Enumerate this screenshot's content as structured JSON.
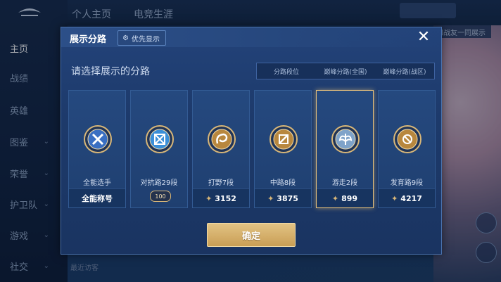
{
  "background": {
    "sidebar": [
      {
        "label": "主页",
        "active": true,
        "chev": false
      },
      {
        "label": "战绩",
        "active": false,
        "chev": false
      },
      {
        "label": "英雄",
        "active": false,
        "chev": false
      },
      {
        "label": "图鉴",
        "active": false,
        "chev": true
      },
      {
        "label": "荣誉",
        "active": false,
        "chev": true
      },
      {
        "label": "护卫队",
        "active": false,
        "chev": true
      },
      {
        "label": "游戏",
        "active": false,
        "chev": true
      },
      {
        "label": "社交",
        "active": false,
        "chev": true
      }
    ],
    "top_tabs": [
      "个人主页",
      "电竞生涯"
    ],
    "hint_text": "和战友一同展示",
    "bottom_left_text": "最近访客"
  },
  "dialog": {
    "title": "展示分路",
    "priority_label": "优先显示",
    "close_icon": "close-icon",
    "prompt": "请选择展示的分路",
    "tabs": [
      {
        "label": "分路段位",
        "active": true
      },
      {
        "label": "巅峰分路(全国)",
        "active": false
      },
      {
        "label": "巅峰分路(战区)",
        "active": false
      }
    ],
    "confirm_label": "确定"
  },
  "cards": [
    {
      "name": "全能选手",
      "foot": "全能称号",
      "kind": "text",
      "emblem": "all-round-emblem-icon",
      "selected": false
    },
    {
      "name": "对抗路29段",
      "foot": "",
      "kind": "badge",
      "badge": "100",
      "emblem": "clash-lane-emblem-icon",
      "selected": false
    },
    {
      "name": "打野7段",
      "foot": "3152",
      "kind": "score",
      "emblem": "jungle-emblem-icon",
      "selected": false
    },
    {
      "name": "中路8段",
      "foot": "3875",
      "kind": "score",
      "emblem": "mid-lane-emblem-icon",
      "selected": false
    },
    {
      "name": "游走2段",
      "foot": "899",
      "kind": "score",
      "emblem": "roam-emblem-icon",
      "selected": true
    },
    {
      "name": "发育路9段",
      "foot": "4217",
      "kind": "score",
      "emblem": "farm-lane-emblem-icon",
      "selected": false
    }
  ],
  "colors": {
    "accent_gold": "#e9c27b",
    "active_tab": "#3a6fc2",
    "panel": "#1d3a6b"
  }
}
